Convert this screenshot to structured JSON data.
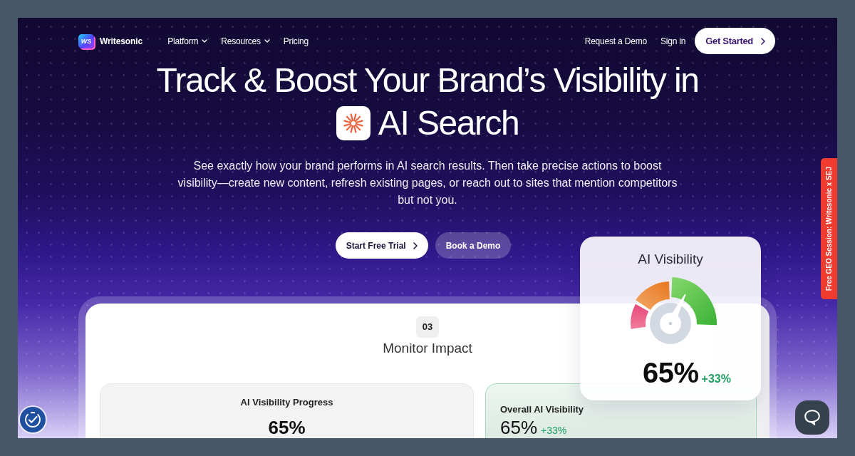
{
  "nav": {
    "logo": {
      "mark": "WS",
      "name": "Writesonic"
    },
    "links": [
      {
        "label": "Platform",
        "dropdown": true
      },
      {
        "label": "Resources",
        "dropdown": true
      },
      {
        "label": "Pricing",
        "dropdown": false
      }
    ],
    "actions": [
      {
        "label": "Request a Demo",
        "kind": "link"
      },
      {
        "label": "Sign in",
        "kind": "link"
      },
      {
        "label": "Get Started",
        "kind": "button"
      }
    ]
  },
  "hero": {
    "title_line_1": "Track & Boost Your Brand’s Visibility in",
    "title_line_2": "AI Search",
    "description": "See exactly how your brand performs in AI search results. Then take precise actions to boost visibility—create new content, refresh existing pages, or reach out to sites that mention competitors but not you.",
    "buttons": [
      {
        "label": "Start Free Trial",
        "kind": "primary"
      },
      {
        "label": "Book a Demo",
        "kind": "secondary"
      }
    ]
  },
  "feature_card": {
    "step": "03",
    "title": "Monitor Impact",
    "panels": [
      {
        "kind": "progress",
        "title": "AI Visibility Progress",
        "value": "65%"
      },
      {
        "kind": "summary",
        "title": "Overall AI Visibility",
        "value": "65%",
        "change": "+33%"
      }
    ]
  },
  "gauge_card": {
    "title": "AI Visibility",
    "level": 0.65,
    "value": "65%",
    "change": "+33%"
  },
  "side_tab": {
    "label": "Free GEO Session: Writesonic x SEJ"
  }
}
